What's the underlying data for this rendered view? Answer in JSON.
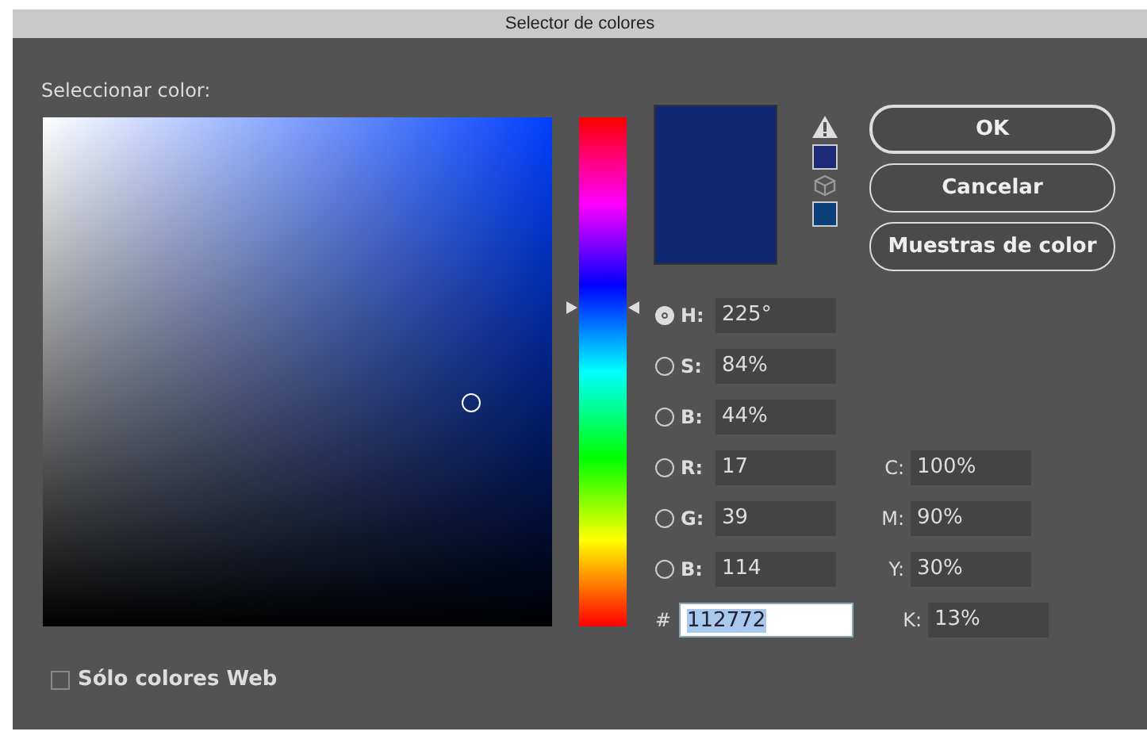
{
  "window": {
    "title": "Selector de colores"
  },
  "prompt": "Seleccionar color:",
  "preview": {
    "color": "#112772"
  },
  "gamut_swatches": [
    {
      "kind": "warning",
      "color": "#1c2a78"
    },
    {
      "kind": "cube",
      "color": "#0a3f7a"
    }
  ],
  "buttons": [
    {
      "label": "OK",
      "kind": "default"
    },
    {
      "label": "Cancelar",
      "kind": "normal"
    },
    {
      "label": "Muestras de color",
      "kind": "normal"
    }
  ],
  "channels": [
    {
      "label": "H:",
      "value": "225°",
      "selected": true
    },
    {
      "label": "S:",
      "value": "84%",
      "selected": false
    },
    {
      "label": "B:",
      "value": "44%",
      "selected": false
    },
    {
      "label": "R:",
      "value": "17",
      "selected": false
    },
    {
      "label": "G:",
      "value": "39",
      "selected": false
    },
    {
      "label": "B:",
      "value": "114",
      "selected": false
    }
  ],
  "hex": {
    "label": "#",
    "value": "112772"
  },
  "cmyk": [
    {
      "label": "C:",
      "value": "100%"
    },
    {
      "label": "M:",
      "value": "90%"
    },
    {
      "label": "Y:",
      "value": "30%"
    },
    {
      "label": "K:",
      "value": "13%"
    }
  ],
  "web_only": {
    "label": "Sólo colores Web",
    "checked": false
  }
}
